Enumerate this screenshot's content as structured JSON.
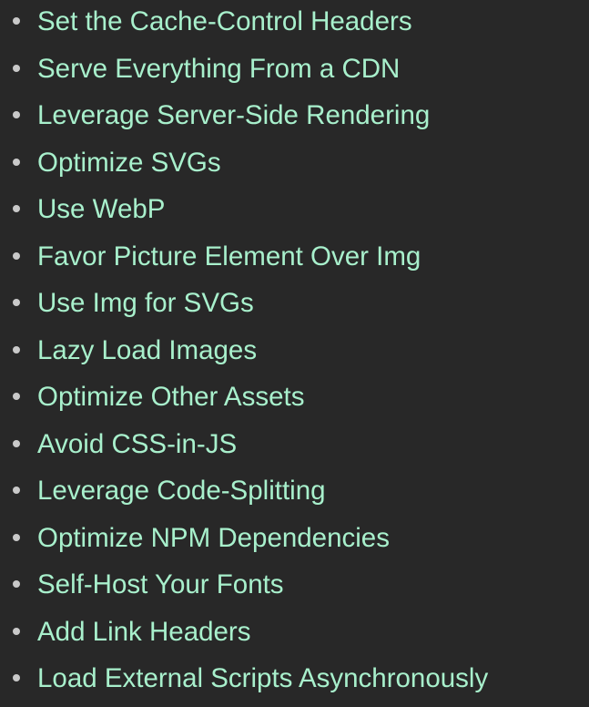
{
  "colors": {
    "background": "#282828",
    "link_text": "#a8f0cc",
    "bullet": "#c9c9c9"
  },
  "list": {
    "items": [
      {
        "label": "Set the Cache-Control Headers"
      },
      {
        "label": "Serve Everything From a CDN"
      },
      {
        "label": "Leverage Server-Side Rendering"
      },
      {
        "label": "Optimize SVGs"
      },
      {
        "label": "Use WebP"
      },
      {
        "label": "Favor Picture Element Over Img"
      },
      {
        "label": "Use Img for SVGs"
      },
      {
        "label": "Lazy Load Images"
      },
      {
        "label": "Optimize Other Assets"
      },
      {
        "label": "Avoid CSS-in-JS"
      },
      {
        "label": "Leverage Code-Splitting"
      },
      {
        "label": "Optimize NPM Dependencies"
      },
      {
        "label": "Self-Host Your Fonts"
      },
      {
        "label": "Add Link Headers"
      },
      {
        "label": "Load External Scripts Asynchronously"
      }
    ]
  }
}
